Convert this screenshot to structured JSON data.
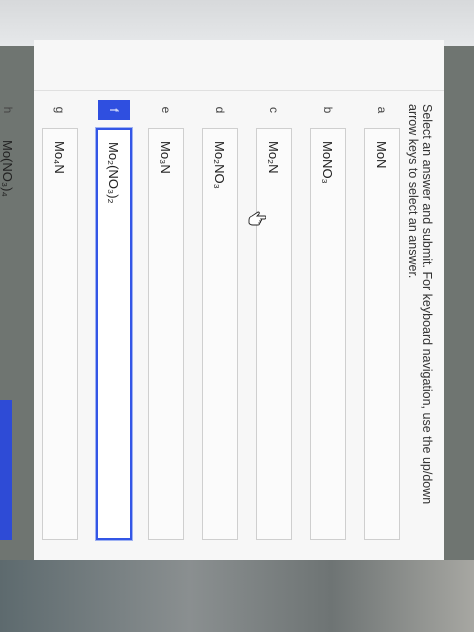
{
  "question": {
    "prompt": "Select an answer and submit. For keyboard navigation, use the up/down arrow keys to select an answer."
  },
  "options": [
    {
      "letter": "a",
      "label": "MoN"
    },
    {
      "letter": "b",
      "label": "MoNO₃"
    },
    {
      "letter": "c",
      "label": "Mo₂N"
    },
    {
      "letter": "d",
      "label": "Mo₂NO₃"
    },
    {
      "letter": "e",
      "label": "Mo₃N"
    },
    {
      "letter": "f",
      "label": "Mo₂(NO₃)₂"
    },
    {
      "letter": "g",
      "label": "Mo₄N"
    },
    {
      "letter": "h",
      "label": "Mo(NO₃)₄"
    }
  ],
  "selected_option": "f",
  "colors": {
    "accent": "#2f4fe0"
  },
  "icons": {
    "cursor": "hand-pointer-icon"
  }
}
